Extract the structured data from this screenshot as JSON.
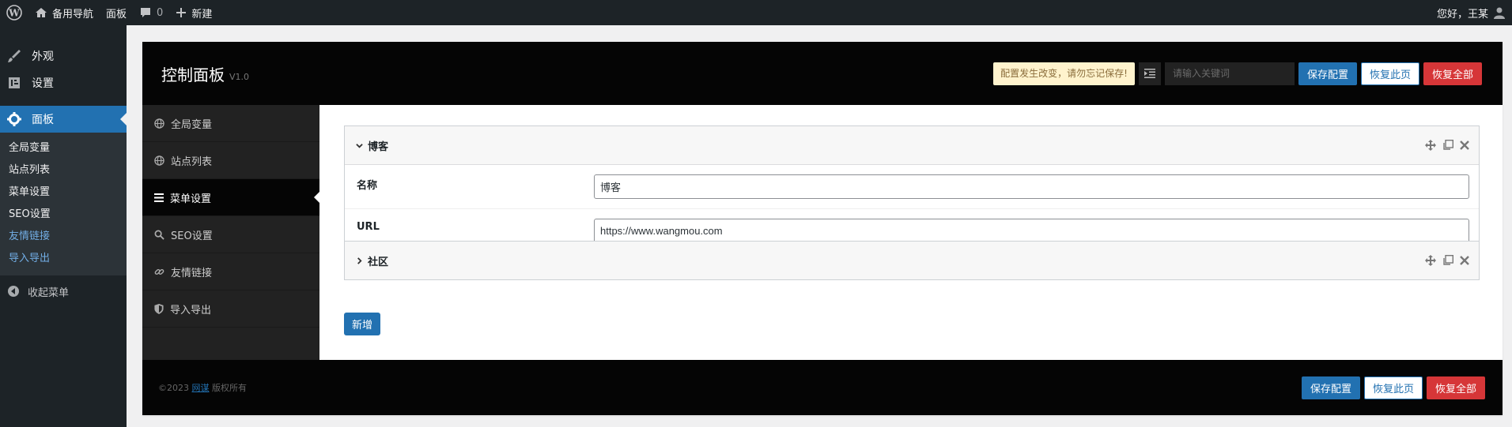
{
  "admin_bar": {
    "site_name": "备用导航",
    "dashboard": "面板",
    "comments_count": "0",
    "new_label": "新建",
    "greeting": "您好，王某"
  },
  "admin_menu": {
    "appearance": "外观",
    "settings": "设置",
    "panel": "面板",
    "sub_items": [
      {
        "label": "全局变量"
      },
      {
        "label": "站点列表"
      },
      {
        "label": "菜单设置"
      },
      {
        "label": "SEO设置"
      },
      {
        "label": "友情链接"
      },
      {
        "label": "导入导出"
      }
    ],
    "collapse": "收起菜单"
  },
  "panel": {
    "title": "控制面板",
    "version": "V1.0",
    "notice": "配置发生改变，请勿忘记保存!",
    "search_placeholder": "请输入关键词",
    "save": "保存配置",
    "reset_section": "恢复此页",
    "reset_all": "恢复全部"
  },
  "nav": [
    {
      "label": "全局变量",
      "icon": "globe-icon"
    },
    {
      "label": "站点列表",
      "icon": "globe-icon"
    },
    {
      "label": "菜单设置",
      "icon": "bars-icon"
    },
    {
      "label": "SEO设置",
      "icon": "search-icon"
    },
    {
      "label": "友情链接",
      "icon": "link-icon"
    },
    {
      "label": "导入导出",
      "icon": "shield-icon"
    }
  ],
  "groups": [
    {
      "title": "博客",
      "fields": [
        {
          "label": "名称",
          "value": "博客"
        },
        {
          "label": "URL",
          "value": "https://www.wangmou.com"
        }
      ]
    },
    {
      "title": "社区"
    }
  ],
  "add_label": "新增",
  "footer": {
    "prefix": "©2023 ",
    "link": "网谋",
    "suffix": " 版权所有"
  },
  "colors": {
    "accent": "#2271b1",
    "danger": "#d63638",
    "admin_bg": "#1d2327"
  }
}
